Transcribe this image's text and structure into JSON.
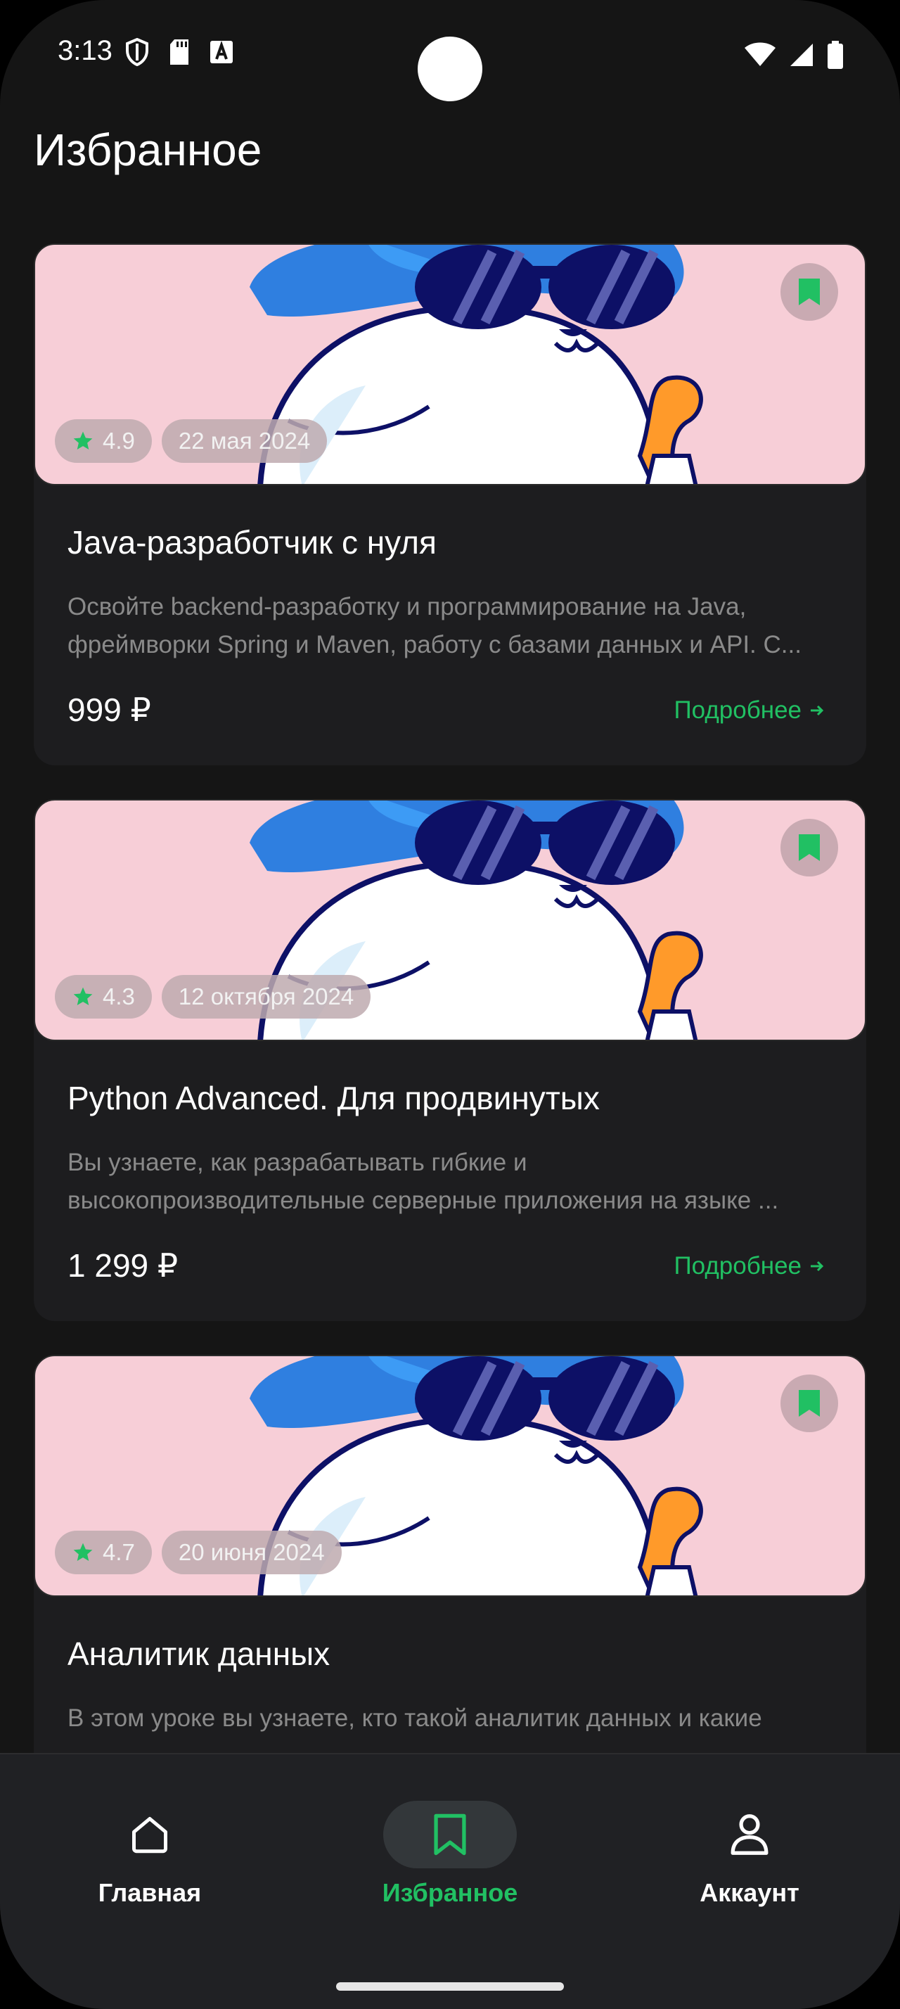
{
  "status_bar": {
    "time": "3:13"
  },
  "header": {
    "title": "Избранное"
  },
  "courses": [
    {
      "rating": "4.9",
      "date": "22 мая 2024",
      "title": "Java-разработчик с нуля",
      "description_line1": "Освойте backend-разработку и программирование на Java,",
      "description_line2": "фреймворки Spring и Maven, работу с базами данных и API. С...",
      "price": "999 ₽",
      "more_label": "Подробнее"
    },
    {
      "rating": "4.3",
      "date": "12 октября 2024",
      "title": "Python Advanced. Для продвинутых",
      "description_line1": "Вы узнаете, как разрабатывать гибкие и",
      "description_line2": "высокопроизводительные серверные приложения на языке ...",
      "price": "1 299 ₽",
      "more_label": "Подробнее"
    },
    {
      "rating": "4.7",
      "date": "20 июня 2024",
      "title": "Аналитик данных",
      "description_line1": "В этом уроке вы узнаете, кто такой аналитик данных и какие",
      "description_line2": "",
      "price": "",
      "more_label": ""
    }
  ],
  "bottom_nav": {
    "items": [
      {
        "label": "Главная",
        "icon": "home-icon",
        "active": false
      },
      {
        "label": "Избранное",
        "icon": "bookmark-icon",
        "active": true
      },
      {
        "label": "Аккаунт",
        "icon": "person-icon",
        "active": false
      }
    ]
  },
  "colors": {
    "accent": "#21c063",
    "background": "#151515",
    "card": "#1d1d1f",
    "image_bg": "#f7ced7"
  }
}
